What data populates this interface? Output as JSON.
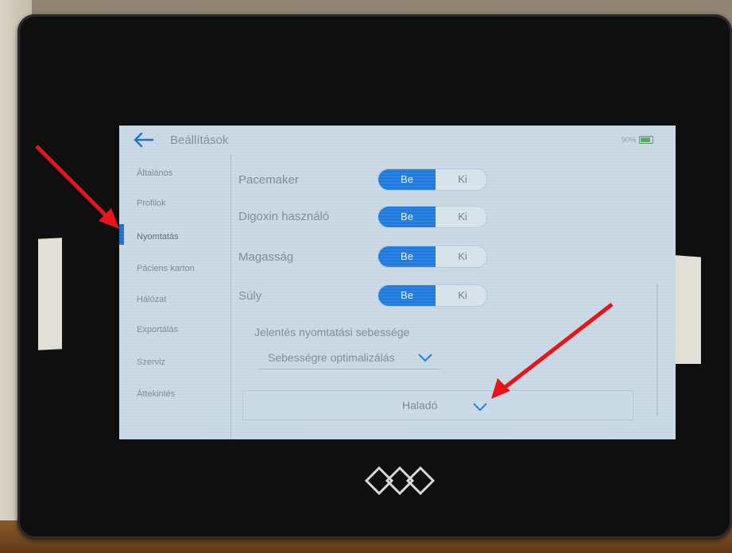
{
  "header": {
    "title": "Beállítások",
    "battery": "90%"
  },
  "sidebar": {
    "active_index": 2,
    "items": [
      {
        "label": "Általános"
      },
      {
        "label": "Profilok"
      },
      {
        "label": "Nyomtatás"
      },
      {
        "label": "Páciens karton"
      },
      {
        "label": "Hálózat"
      },
      {
        "label": "Exportálás"
      },
      {
        "label": "Szerviz"
      },
      {
        "label": "Áttekintés"
      }
    ]
  },
  "print_settings": {
    "rows": [
      {
        "label": "Pacemaker",
        "on": "Be",
        "off": "Ki",
        "state": "on"
      },
      {
        "label": "Digoxin használó",
        "on": "Be",
        "off": "Ki",
        "state": "on"
      },
      {
        "label": "Magasság",
        "on": "Be",
        "off": "Ki",
        "state": "on"
      },
      {
        "label": "Súly",
        "on": "Be",
        "off": "Ki",
        "state": "on"
      }
    ],
    "speed": {
      "label": "Jelentés nyomtatási sebessége",
      "value": "Sebességre optimalizálás"
    },
    "advanced": {
      "label": "Haladó"
    }
  },
  "colors": {
    "accent": "#1e7be0",
    "screen_bg": "#c7d8e4",
    "arrow": "#e8141a"
  },
  "icons": {
    "back": "arrow-left-icon",
    "battery": "battery-icon",
    "chevron": "chevron-down-icon",
    "logo": "btl-logo-icon"
  }
}
